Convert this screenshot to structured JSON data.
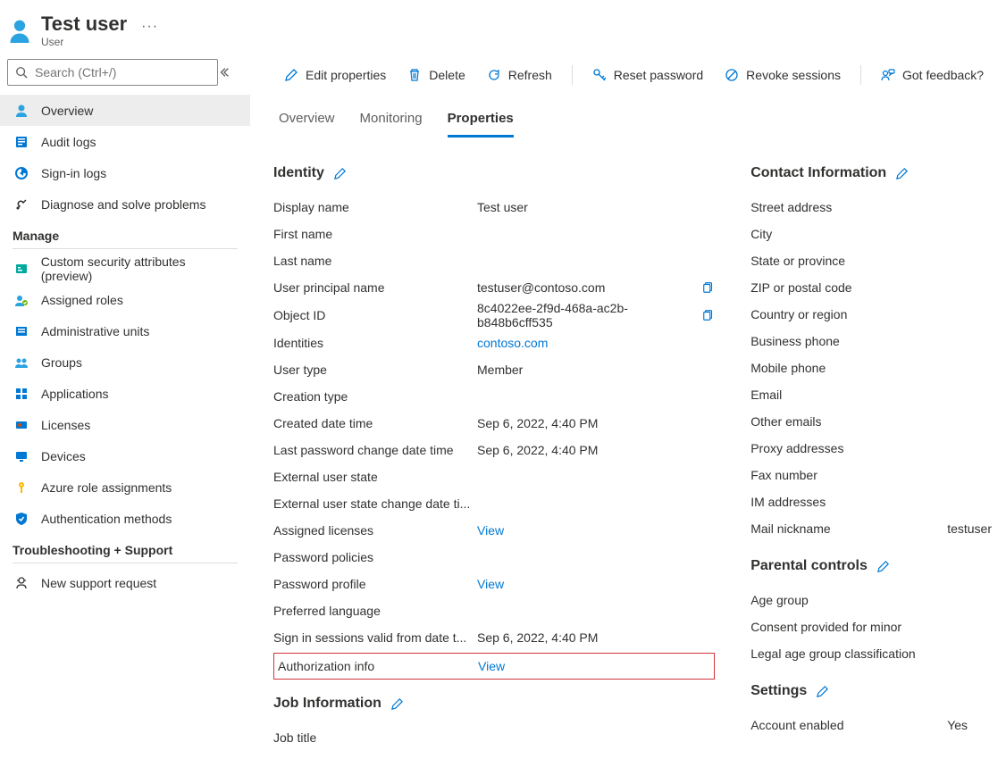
{
  "header": {
    "title": "Test user",
    "subtitle": "User"
  },
  "search": {
    "placeholder": "Search (Ctrl+/)"
  },
  "sidebar": {
    "items_top": [
      {
        "label": "Overview",
        "name": "sidebar-item-overview",
        "selected": true
      },
      {
        "label": "Audit logs",
        "name": "sidebar-item-audit-logs",
        "selected": false
      },
      {
        "label": "Sign-in logs",
        "name": "sidebar-item-signin-logs",
        "selected": false
      },
      {
        "label": "Diagnose and solve problems",
        "name": "sidebar-item-diagnose",
        "selected": false
      }
    ],
    "group_manage": "Manage",
    "items_manage": [
      {
        "label": "Custom security attributes (preview)",
        "name": "sidebar-item-custom-security-attrs"
      },
      {
        "label": "Assigned roles",
        "name": "sidebar-item-assigned-roles"
      },
      {
        "label": "Administrative units",
        "name": "sidebar-item-admin-units"
      },
      {
        "label": "Groups",
        "name": "sidebar-item-groups"
      },
      {
        "label": "Applications",
        "name": "sidebar-item-applications"
      },
      {
        "label": "Licenses",
        "name": "sidebar-item-licenses"
      },
      {
        "label": "Devices",
        "name": "sidebar-item-devices"
      },
      {
        "label": "Azure role assignments",
        "name": "sidebar-item-azure-roles"
      },
      {
        "label": "Authentication methods",
        "name": "sidebar-item-auth-methods"
      }
    ],
    "group_trouble": "Troubleshooting + Support",
    "items_trouble": [
      {
        "label": "New support request",
        "name": "sidebar-item-new-support"
      }
    ]
  },
  "toolbar": {
    "edit": "Edit properties",
    "delete": "Delete",
    "refresh": "Refresh",
    "reset": "Reset password",
    "revoke": "Revoke sessions",
    "feedback": "Got feedback?"
  },
  "tabs": {
    "overview": "Overview",
    "monitoring": "Monitoring",
    "properties": "Properties"
  },
  "sections": {
    "identity": "Identity",
    "jobinfo": "Job Information",
    "contact": "Contact Information",
    "parental": "Parental controls",
    "settings": "Settings"
  },
  "identity": {
    "rows": [
      {
        "k": "Display name",
        "v": "Test user"
      },
      {
        "k": "First name",
        "v": ""
      },
      {
        "k": "Last name",
        "v": ""
      },
      {
        "k": "User principal name",
        "v": "testuser@contoso.com",
        "copy": true
      },
      {
        "k": "Object ID",
        "v": "8c4022ee-2f9d-468a-ac2b-b848b6cff535",
        "copy": true
      },
      {
        "k": "Identities",
        "v": "contoso.com",
        "link": true
      },
      {
        "k": "User type",
        "v": "Member"
      },
      {
        "k": "Creation type",
        "v": ""
      },
      {
        "k": "Created date time",
        "v": "Sep 6, 2022, 4:40 PM"
      },
      {
        "k": "Last password change date time",
        "v": "Sep 6, 2022, 4:40 PM"
      },
      {
        "k": "External user state",
        "v": ""
      },
      {
        "k": "External user state change date ti...",
        "v": ""
      },
      {
        "k": "Assigned licenses",
        "v": "View",
        "link": true
      },
      {
        "k": "Password policies",
        "v": ""
      },
      {
        "k": "Password profile",
        "v": "View",
        "link": true
      },
      {
        "k": "Preferred language",
        "v": ""
      },
      {
        "k": "Sign in sessions valid from date t...",
        "v": "Sep 6, 2022, 4:40 PM"
      }
    ],
    "highlight": {
      "k": "Authorization info",
      "v": "View"
    }
  },
  "jobinfo": {
    "rows": [
      {
        "k": "Job title",
        "v": ""
      }
    ]
  },
  "contact": {
    "rows": [
      {
        "k": "Street address",
        "v": ""
      },
      {
        "k": "City",
        "v": ""
      },
      {
        "k": "State or province",
        "v": ""
      },
      {
        "k": "ZIP or postal code",
        "v": ""
      },
      {
        "k": "Country or region",
        "v": ""
      },
      {
        "k": "Business phone",
        "v": ""
      },
      {
        "k": "Mobile phone",
        "v": ""
      },
      {
        "k": "Email",
        "v": ""
      },
      {
        "k": "Other emails",
        "v": ""
      },
      {
        "k": "Proxy addresses",
        "v": ""
      },
      {
        "k": "Fax number",
        "v": ""
      },
      {
        "k": "IM addresses",
        "v": ""
      },
      {
        "k": "Mail nickname",
        "v": "testuser"
      }
    ]
  },
  "parental": {
    "rows": [
      {
        "k": "Age group",
        "v": ""
      },
      {
        "k": "Consent provided for minor",
        "v": ""
      },
      {
        "k": "Legal age group classification",
        "v": ""
      }
    ]
  },
  "settings": {
    "rows": [
      {
        "k": "Account enabled",
        "v": "Yes"
      }
    ]
  }
}
